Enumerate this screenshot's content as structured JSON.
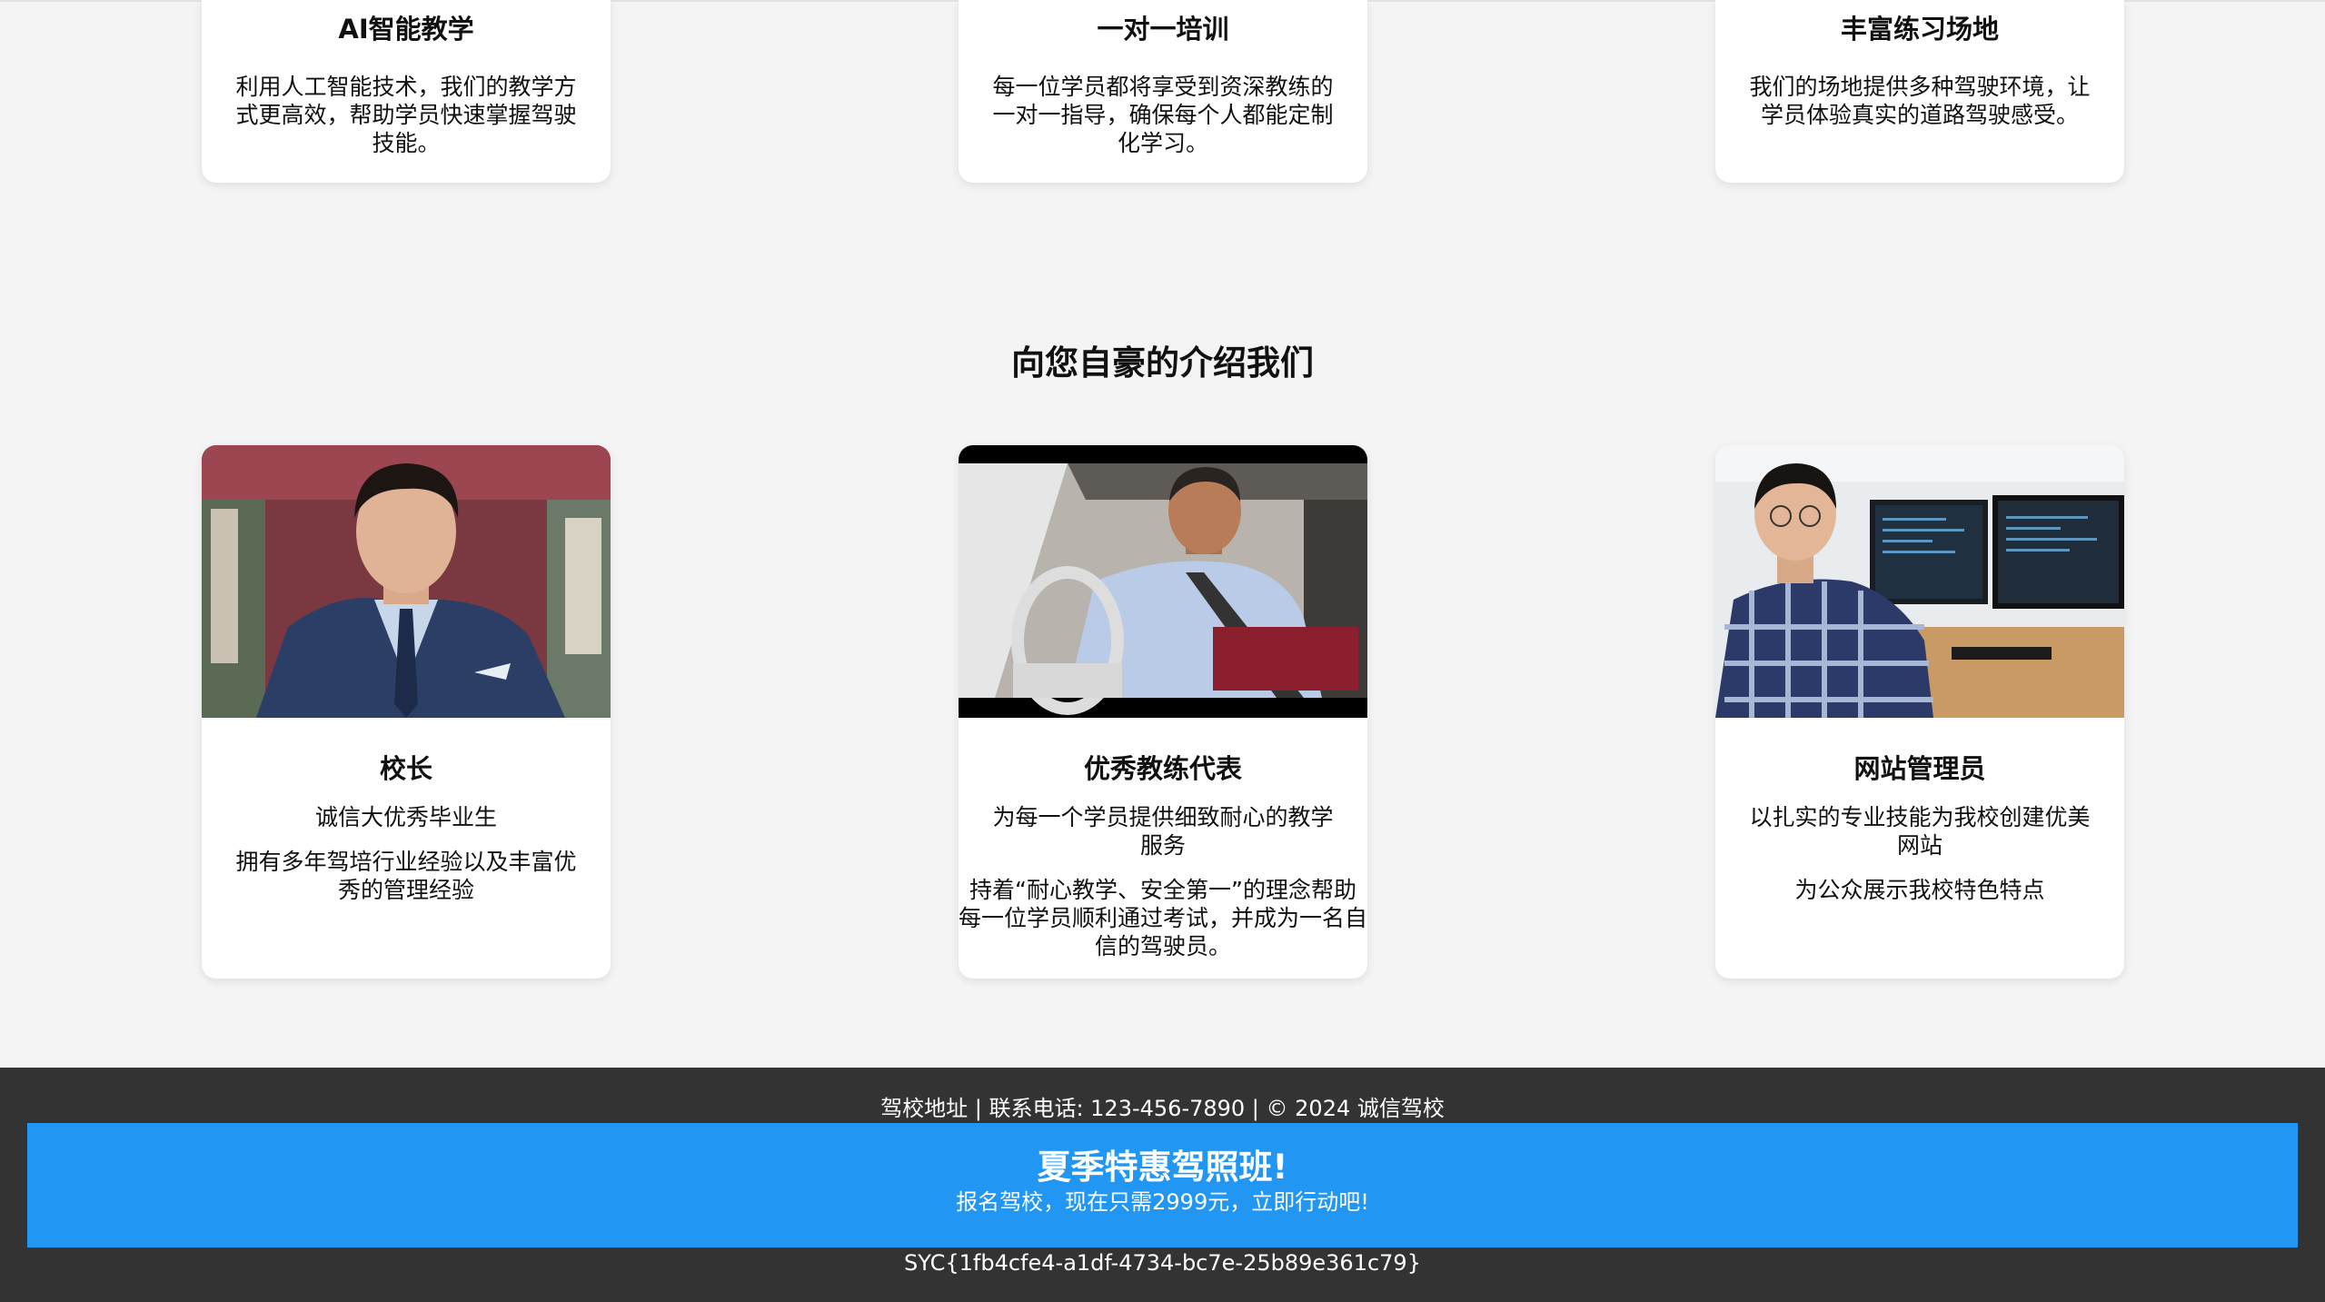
{
  "features": [
    {
      "title": "AI智能教学",
      "desc": "利用人工智能技术，我们的教学方式更高效，帮助学员快速掌握驾驶技能。"
    },
    {
      "title": "一对一培训",
      "desc": "每一位学员都将享受到资深教练的一对一指导，确保每个人都能定制化学习。"
    },
    {
      "title": "丰富练习场地",
      "desc": "我们的场地提供多种驾驶环境，让学员体验真实的道路驾驶感受。"
    }
  ],
  "team_section": {
    "title": "向您自豪的介绍我们",
    "members": [
      {
        "role": "校长",
        "line1": "诚信大优秀毕业生",
        "line2": "拥有多年驾培行业经验以及丰富优秀的管理经验"
      },
      {
        "role": "优秀教练代表",
        "line1": "为每一个学员提供细致耐心的教学服务",
        "line2": "持着“耐心教学、安全第一”的理念帮助每一位学员顺利通过考试，并成为一名自信的驾驶员。"
      },
      {
        "role": "网站管理员",
        "line1": "以扎实的专业技能为我校创建优美网站",
        "line2": "为公众展示我校特色特点"
      }
    ]
  },
  "footer": {
    "info": "驾校地址 | 联系电话: 123-456-7890 | © 2024 诚信驾校",
    "promo_title": "夏季特惠驾照班!",
    "promo_text": "报名驾校，现在只需2999元，立即行动吧!",
    "flag": "SYC{1fb4cfe4-a1df-4734-bc7e-25b89e361c79}"
  },
  "colors": {
    "page_bg": "#f4f4f4",
    "footer_bg": "#333333",
    "promo_bg": "#2196f3"
  }
}
